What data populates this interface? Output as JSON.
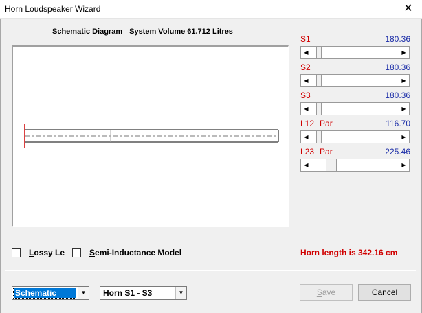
{
  "window": {
    "title": "Horn Loudspeaker Wizard",
    "close_glyph": "✕"
  },
  "diagram": {
    "heading": "Schematic Diagram",
    "volume_label": "System Volume 61.712 Litres"
  },
  "params": [
    {
      "label": "S1",
      "sub": "",
      "value": "180.36",
      "position": 0.05
    },
    {
      "label": "S2",
      "sub": "",
      "value": "180.36",
      "position": 0.05
    },
    {
      "label": "S3",
      "sub": "",
      "value": "180.36",
      "position": 0.05
    },
    {
      "label": "L12",
      "sub": "Par",
      "value": "116.70",
      "position": 0.05
    },
    {
      "label": "L23",
      "sub": "Par",
      "value": "225.46",
      "position": 0.2
    }
  ],
  "options": {
    "lossy_prefix": "L",
    "lossy_rest": "ossy Le",
    "semi_prefix": "S",
    "semi_rest": "emi-Inductance Model"
  },
  "status": {
    "horn_length": "Horn length is 342.16 cm"
  },
  "view_combo": {
    "selected": "Schematic"
  },
  "horn_combo": {
    "selected": "Horn S1 - S3"
  },
  "buttons": {
    "save_prefix": "S",
    "save_rest": "ave",
    "save_enabled": false,
    "cancel": "Cancel"
  },
  "colors": {
    "param_label": "#d00000",
    "param_value": "#1c2ea8",
    "status": "#d00000",
    "selection": "#0078d7"
  }
}
